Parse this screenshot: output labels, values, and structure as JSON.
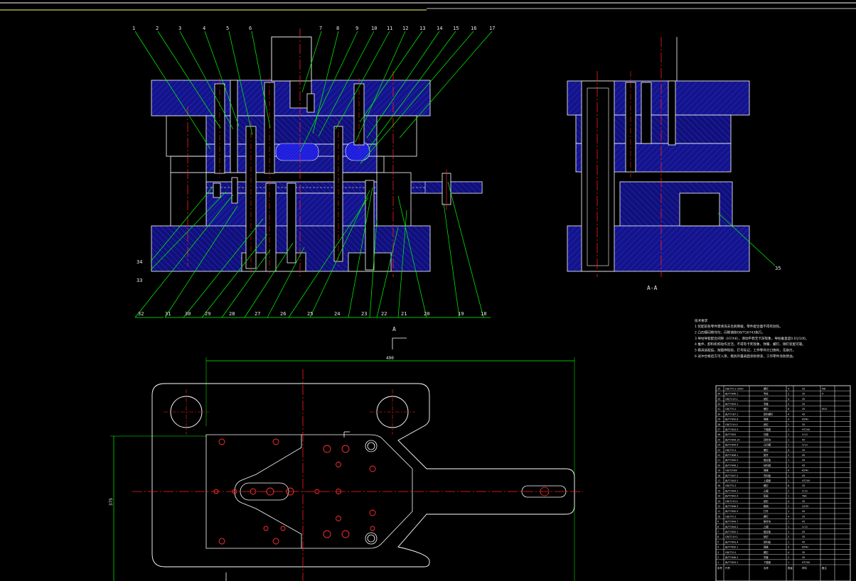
{
  "colors": {
    "background": "#000000",
    "outline": "#ffffff",
    "leader": "#00ff00",
    "hatch": "#1a1aa0",
    "hatch_dark": "#0d0d70",
    "center_line": "#ff2020",
    "hole": "#ff3030",
    "border": "#ffff66"
  },
  "main_view": {
    "labels_top": [
      "1",
      "2",
      "3",
      "4",
      "5",
      "6",
      "7",
      "8",
      "9",
      "10",
      "11",
      "12",
      "13",
      "14",
      "15",
      "16",
      "17"
    ],
    "labels_bottom": [
      "32",
      "31",
      "30",
      "29",
      "28",
      "27",
      "26",
      "25",
      "24",
      "23",
      "22",
      "21",
      "20",
      "19",
      "18"
    ],
    "labels_left": [
      "34",
      "33"
    ]
  },
  "section_view": {
    "caption": "A-A",
    "label_right": "35"
  },
  "plan_view": {
    "section_mark": "A",
    "dim_width": "490",
    "dim_height": "375"
  },
  "tech_notes": {
    "title": "技术要求",
    "lines": [
      "1 装配前各零件需清洗去毛刺倒棱，零件配合面不得有划伤。",
      "2 凸凹模间隙均匀，间隙值按GB/T16743执行。",
      "3 导柱导套配合间隙（H7/h6），滑动平稳无卡滞现象，导柱垂直度0.01/100。",
      "4 推件、卸料机构动作灵活，不得有卡死现象，弹簧、螺钉、销钉装配可靠。",
      "5 模具装配后，按图样检验，打号标记，工作零件刃口锋利，无崩刃。",
      "6 试冲合格后方可入库，模具外露表面涂防锈漆，工作零件涂防锈油。"
    ]
  },
  "bom_table": {
    "rows": [
      [
        "35",
        "GB/T70.1-2000",
        "螺钉",
        "4",
        "35",
        "M8"
      ],
      [
        "34",
        "JB/T7646.1",
        "导柱",
        "2",
        "20",
        "A"
      ],
      [
        "33",
        "GB/T119.1",
        "销钉",
        "4",
        "35",
        ""
      ],
      [
        "32",
        "JB/T7643.1",
        "导套",
        "2",
        "20",
        ""
      ],
      [
        "31",
        "GB/T70.1",
        "螺钉",
        "6",
        "35",
        "M10"
      ],
      [
        "30",
        "JB/T7187.1",
        "卸料螺钉",
        "4",
        "45",
        ""
      ],
      [
        "29",
        "JB/T7650.8",
        "弹簧",
        "4",
        "65Mn",
        ""
      ],
      [
        "28",
        "GB/T119.1",
        "销钉",
        "2",
        "35",
        ""
      ],
      [
        "27",
        "JB/T7643.5",
        "下模座",
        "1",
        "HT200",
        ""
      ],
      [
        "26",
        "JB/T7653",
        "凹模",
        "1",
        "Cr12",
        ""
      ],
      [
        "25",
        "JB/T7649.10",
        "顶件块",
        "1",
        "45",
        ""
      ],
      [
        "24",
        "JB/T7644.4",
        "凸凹模",
        "1",
        "Cr12",
        ""
      ],
      [
        "23",
        "GB/T70.1",
        "螺钉",
        "4",
        "35",
        ""
      ],
      [
        "22",
        "JB/T7648.1",
        "推杆",
        "2",
        "45",
        ""
      ],
      [
        "21",
        "JB/T7645.5",
        "固定板",
        "1",
        "45",
        ""
      ],
      [
        "20",
        "JB/T7646.1",
        "挡料销",
        "1",
        "45",
        ""
      ],
      [
        "19",
        "GB/T2089",
        "弹簧",
        "6",
        "65Mn",
        ""
      ],
      [
        "18",
        "JB/T7647.2",
        "导料板",
        "2",
        "45",
        ""
      ],
      [
        "17",
        "JB/T7643.2",
        "上模座",
        "1",
        "HT200",
        ""
      ],
      [
        "16",
        "GB/T70.1",
        "螺钉",
        "6",
        "35",
        ""
      ],
      [
        "15",
        "JB/T7644.1",
        "凸模",
        "2",
        "Cr12",
        ""
      ],
      [
        "14",
        "JB/T7642.4",
        "垫板",
        "1",
        "T8A",
        ""
      ],
      [
        "13",
        "GB/T119.1",
        "销钉",
        "4",
        "35",
        ""
      ],
      [
        "12",
        "JB/T7646.3",
        "模柄",
        "1",
        "Q235",
        ""
      ],
      [
        "11",
        "JB/T7650.5",
        "打杆",
        "1",
        "45",
        ""
      ],
      [
        "10",
        "GB/T70.1",
        "螺钉",
        "4",
        "35",
        ""
      ],
      [
        "9",
        "JB/T7649.7",
        "推件块",
        "1",
        "45",
        ""
      ],
      [
        "8",
        "JB/T7644.2",
        "凸模",
        "1",
        "Cr12",
        ""
      ],
      [
        "7",
        "JB/T7645.1",
        "固定板",
        "1",
        "45",
        ""
      ],
      [
        "6",
        "GB/T119.1",
        "销钉",
        "2",
        "35",
        ""
      ],
      [
        "5",
        "JB/T7643.4",
        "卸料板",
        "1",
        "45",
        ""
      ],
      [
        "4",
        "JB/T7650.1",
        "弹簧",
        "4",
        "65Mn",
        ""
      ],
      [
        "3",
        "GB/T70.1",
        "螺钉",
        "4",
        "35",
        ""
      ],
      [
        "2",
        "JB/T7646.2",
        "导套",
        "2",
        "20",
        ""
      ],
      [
        "1",
        "JB/T7643.1",
        "下模座",
        "1",
        "HT200",
        ""
      ]
    ],
    "header": [
      "序号",
      "代号",
      "名称",
      "数量",
      "材料",
      "备注"
    ]
  }
}
